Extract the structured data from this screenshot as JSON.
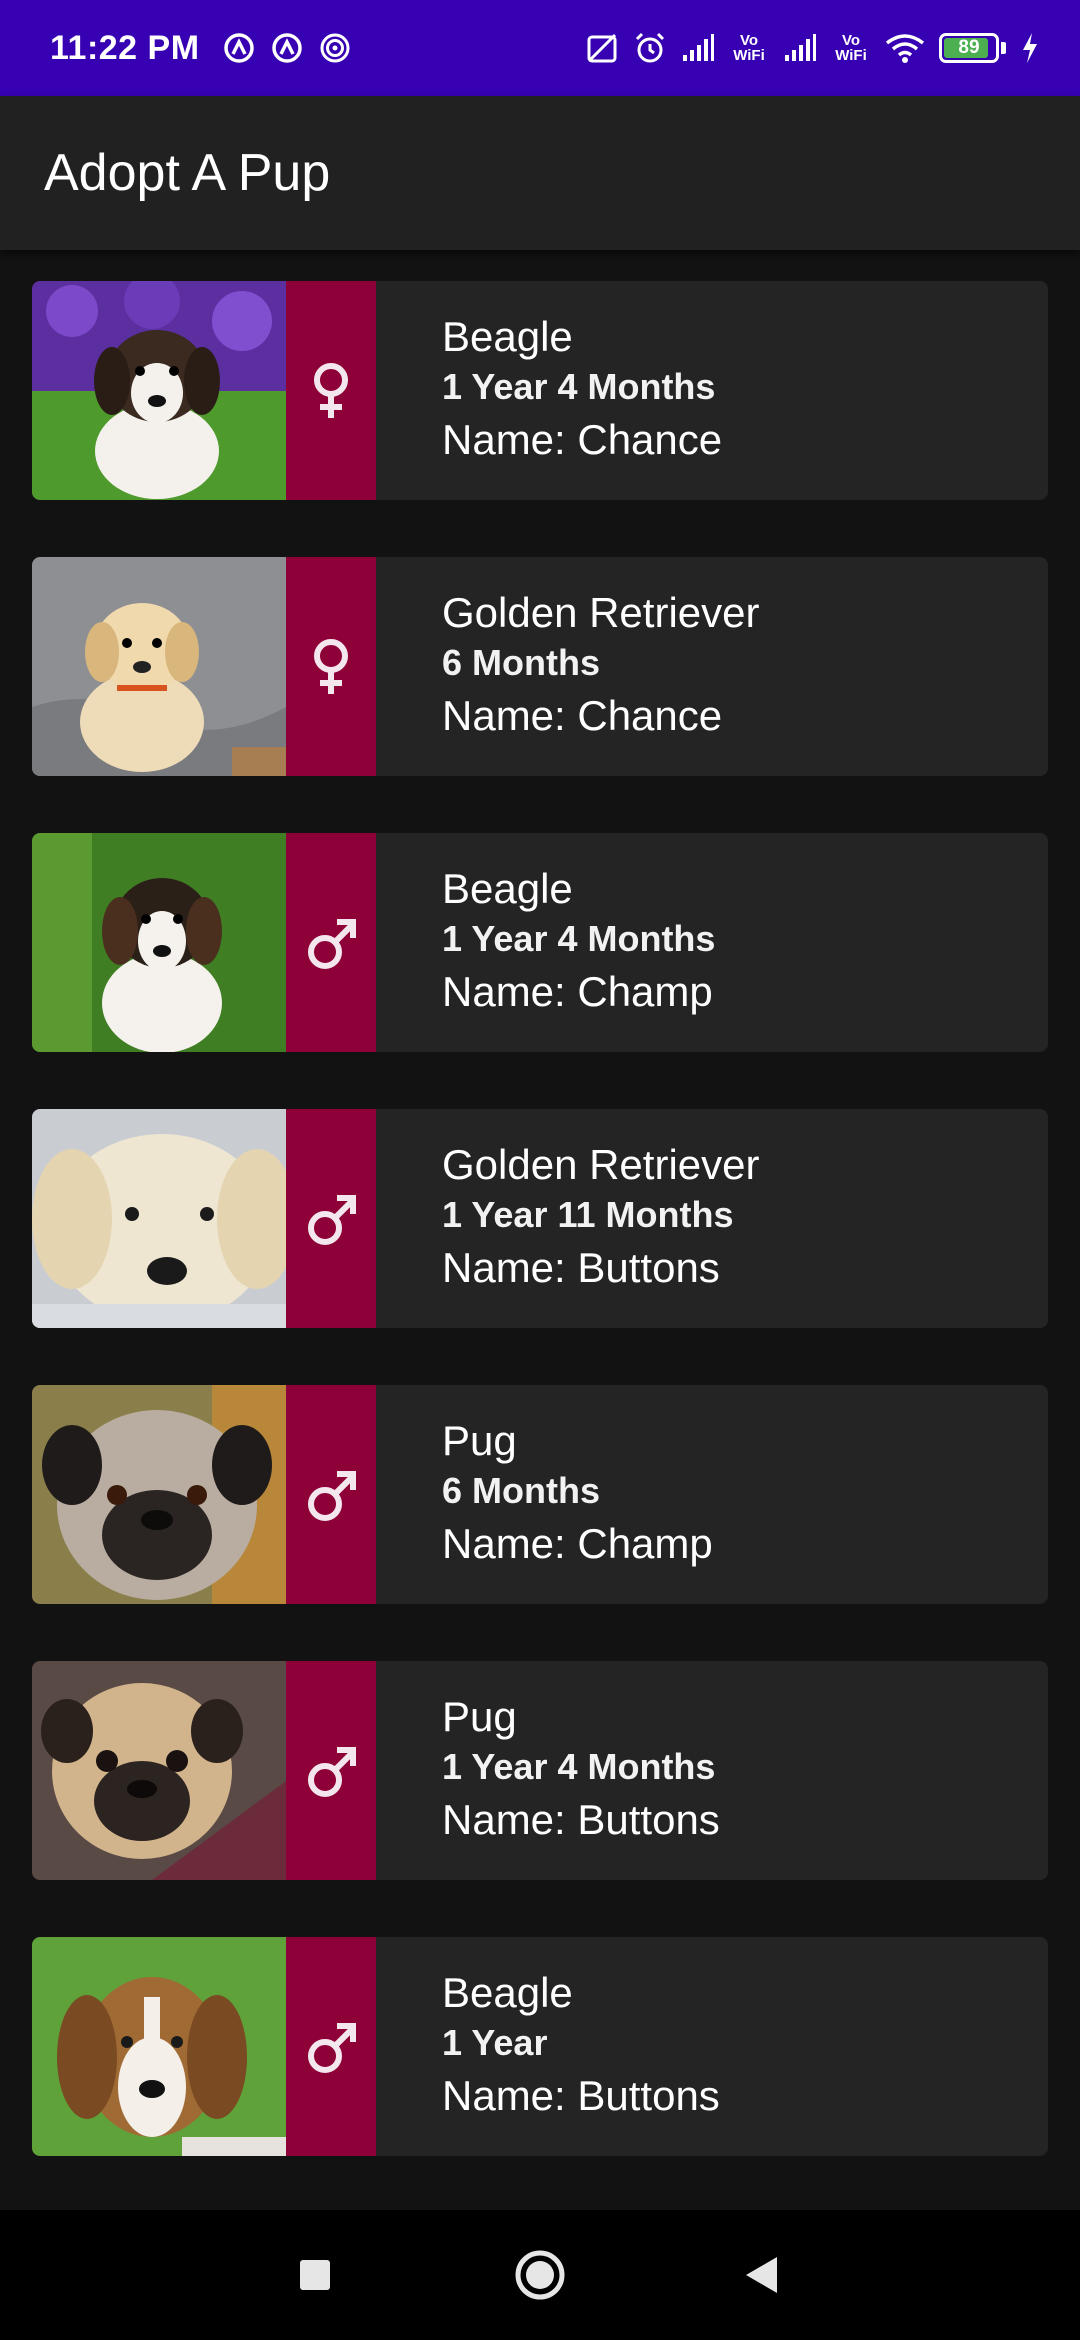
{
  "status_bar": {
    "time": "11:22 PM",
    "vowifi_1": "Vo WiFi",
    "vowifi_2": "Vo WiFi",
    "battery_percent": "89",
    "battery_level": 0.89
  },
  "app_bar": {
    "title": "Adopt A Pup"
  },
  "colors": {
    "status_bar": "#3700b3",
    "app_bar": "#212121",
    "card": "#242424",
    "gender_strip": "#8e0038",
    "background": "#121212"
  },
  "pups": [
    {
      "breed": "Beagle",
      "age": "1 Year 4 Months",
      "name": "Name: Chance",
      "gender": "female",
      "gender_icon": "female-icon",
      "photo": "beagle-puppy-photo"
    },
    {
      "breed": "Golden Retriever",
      "age": "6 Months",
      "name": "Name: Chance",
      "gender": "female",
      "gender_icon": "female-icon",
      "photo": "golden-retriever-puppy-photo"
    },
    {
      "breed": "Beagle",
      "age": "1 Year 4 Months",
      "name": "Name: Champ",
      "gender": "male",
      "gender_icon": "male-icon",
      "photo": "beagle-puppy-photo"
    },
    {
      "breed": "Golden Retriever",
      "age": "1 Year 11 Months",
      "name": "Name: Buttons",
      "gender": "male",
      "gender_icon": "male-icon",
      "photo": "golden-retriever-puppy-photo"
    },
    {
      "breed": "Pug",
      "age": "6 Months",
      "name": "Name: Champ",
      "gender": "male",
      "gender_icon": "male-icon",
      "photo": "pug-puppy-photo"
    },
    {
      "breed": "Pug",
      "age": "1 Year 4 Months",
      "name": "Name: Buttons",
      "gender": "male",
      "gender_icon": "male-icon",
      "photo": "pug-puppy-photo"
    },
    {
      "breed": "Beagle",
      "age": "1 Year",
      "name": "Name: Buttons",
      "gender": "male",
      "gender_icon": "male-icon",
      "photo": "beagle-puppy-photo"
    }
  ],
  "nav_bar": {
    "recents": "square-recents-icon",
    "home": "circle-home-icon",
    "back": "triangle-back-icon"
  }
}
